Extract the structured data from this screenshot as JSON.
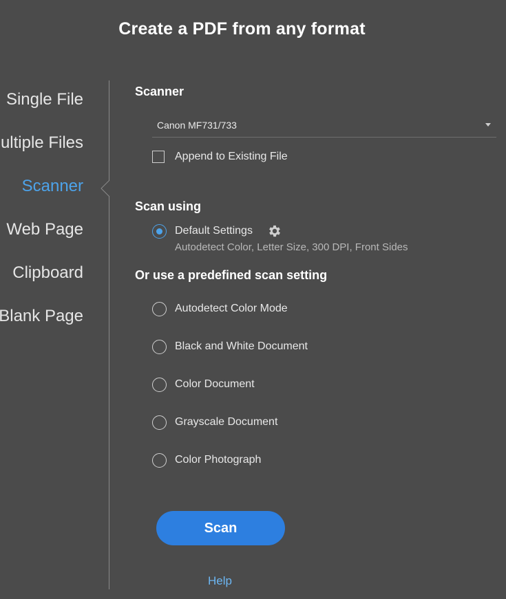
{
  "title": "Create a PDF from any format",
  "nav": {
    "items": [
      {
        "label": "Single File",
        "active": false
      },
      {
        "label": "Multiple Files",
        "active": false
      },
      {
        "label": "Scanner",
        "active": true
      },
      {
        "label": "Web Page",
        "active": false
      },
      {
        "label": "Clipboard",
        "active": false
      },
      {
        "label": "Blank Page",
        "active": false
      }
    ]
  },
  "scanner": {
    "heading": "Scanner",
    "selected_device": "Canon MF731/733",
    "append_label": "Append to Existing File",
    "append_checked": false
  },
  "scan_using": {
    "heading": "Scan using",
    "default_label": "Default Settings",
    "default_selected": true,
    "default_description": "Autodetect Color, Letter Size, 300 DPI, Front Sides",
    "settings_icon": "gear-icon"
  },
  "predefined": {
    "heading": "Or use a predefined scan setting",
    "options": [
      {
        "label": "Autodetect Color Mode",
        "selected": false
      },
      {
        "label": "Black and White Document",
        "selected": false
      },
      {
        "label": "Color Document",
        "selected": false
      },
      {
        "label": "Grayscale Document",
        "selected": false
      },
      {
        "label": "Color Photograph",
        "selected": false
      }
    ]
  },
  "actions": {
    "scan_label": "Scan",
    "help_label": "Help"
  },
  "colors": {
    "background": "#4b4b4b",
    "accent": "#4da3ea",
    "button": "#2d7fe0",
    "link": "#6cb6f2"
  }
}
